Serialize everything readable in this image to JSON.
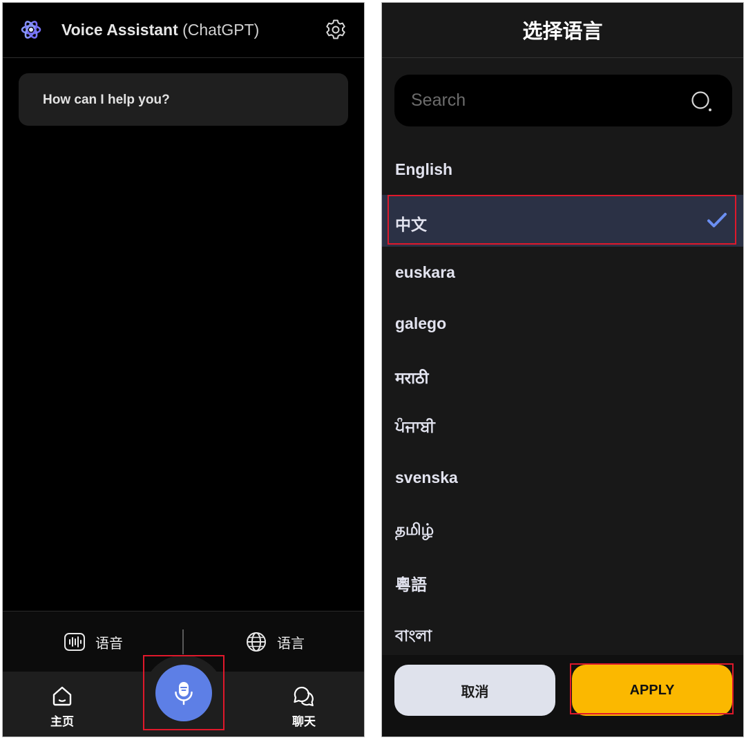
{
  "left": {
    "header": {
      "title_bold": "Voice Assistant",
      "title_sub": "(ChatGPT)",
      "logo_icon": "atom-logo-icon",
      "settings_icon": "gear-icon"
    },
    "chat": {
      "prompt": "How can I help you?"
    },
    "tools": {
      "voice_label": "语音",
      "voice_icon": "soundwave-icon",
      "language_label": "语言",
      "language_icon": "globe-icon"
    },
    "nav": {
      "home_label": "主页",
      "home_icon": "home-icon",
      "chat_label": "聊天",
      "chat_icon": "chat-bubbles-icon",
      "mic_icon": "microphone-icon"
    }
  },
  "right": {
    "title": "选择语言",
    "search": {
      "placeholder": "Search",
      "value": ""
    },
    "languages": [
      {
        "label": "English",
        "selected": false
      },
      {
        "label": "中文",
        "selected": true
      },
      {
        "label": "euskara",
        "selected": false
      },
      {
        "label": "galego",
        "selected": false
      },
      {
        "label": "मराठी",
        "selected": false
      },
      {
        "label": "ਪੰਜਾਬੀ",
        "selected": false
      },
      {
        "label": "svenska",
        "selected": false
      },
      {
        "label": "தமிழ்",
        "selected": false
      },
      {
        "label": "粵語",
        "selected": false
      },
      {
        "label": "বাংলা",
        "selected": false
      }
    ],
    "buttons": {
      "cancel": "取消",
      "apply": "APPLY"
    }
  },
  "colors": {
    "accent_blue": "#5d7fe6",
    "apply_yellow": "#fbb800",
    "highlight_red": "#e0182b",
    "selected_row": "#2b3145"
  }
}
